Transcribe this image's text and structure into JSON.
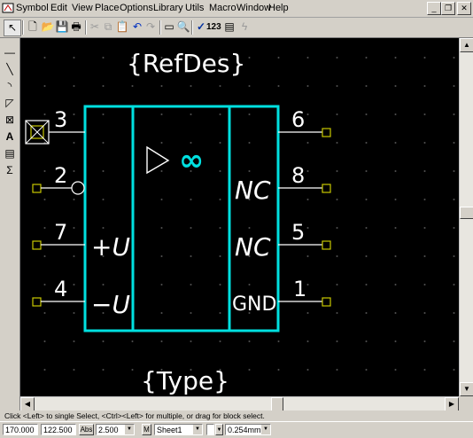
{
  "menu": [
    "Symbol",
    "Edit",
    "View",
    "Place",
    "Options",
    "Library",
    "Utils",
    "Macro",
    "Window",
    "Help"
  ],
  "toolbar": {
    "label_123": "123"
  },
  "schematic": {
    "refdes": "{RefDes}",
    "type": "{Type}",
    "pins_left": [
      {
        "number": "3",
        "label": ""
      },
      {
        "number": "2",
        "label": ""
      },
      {
        "number": "7",
        "label": "+U"
      },
      {
        "number": "4",
        "label": "−U"
      }
    ],
    "pins_right": [
      {
        "number": "6",
        "label": ""
      },
      {
        "number": "8",
        "label": "NC"
      },
      {
        "number": "5",
        "label": "NC"
      },
      {
        "number": "1",
        "label": "GND"
      }
    ],
    "infinity": "∞"
  },
  "status": {
    "hint": "Click <Left> to single Select, <Ctrl><Left> for multiple, or drag for block select."
  },
  "bottom": {
    "x_coord": "170.000",
    "y_coord": "122.500",
    "abs_label": "Abs",
    "grid": "2.500",
    "m_label": "M",
    "sheet": "Sheet1",
    "line_width": "0.254mm"
  },
  "colors": {
    "canvas": "#000000",
    "body": "#00e5e5",
    "pin_marker": "#c8c800",
    "text": "#ffffff"
  }
}
